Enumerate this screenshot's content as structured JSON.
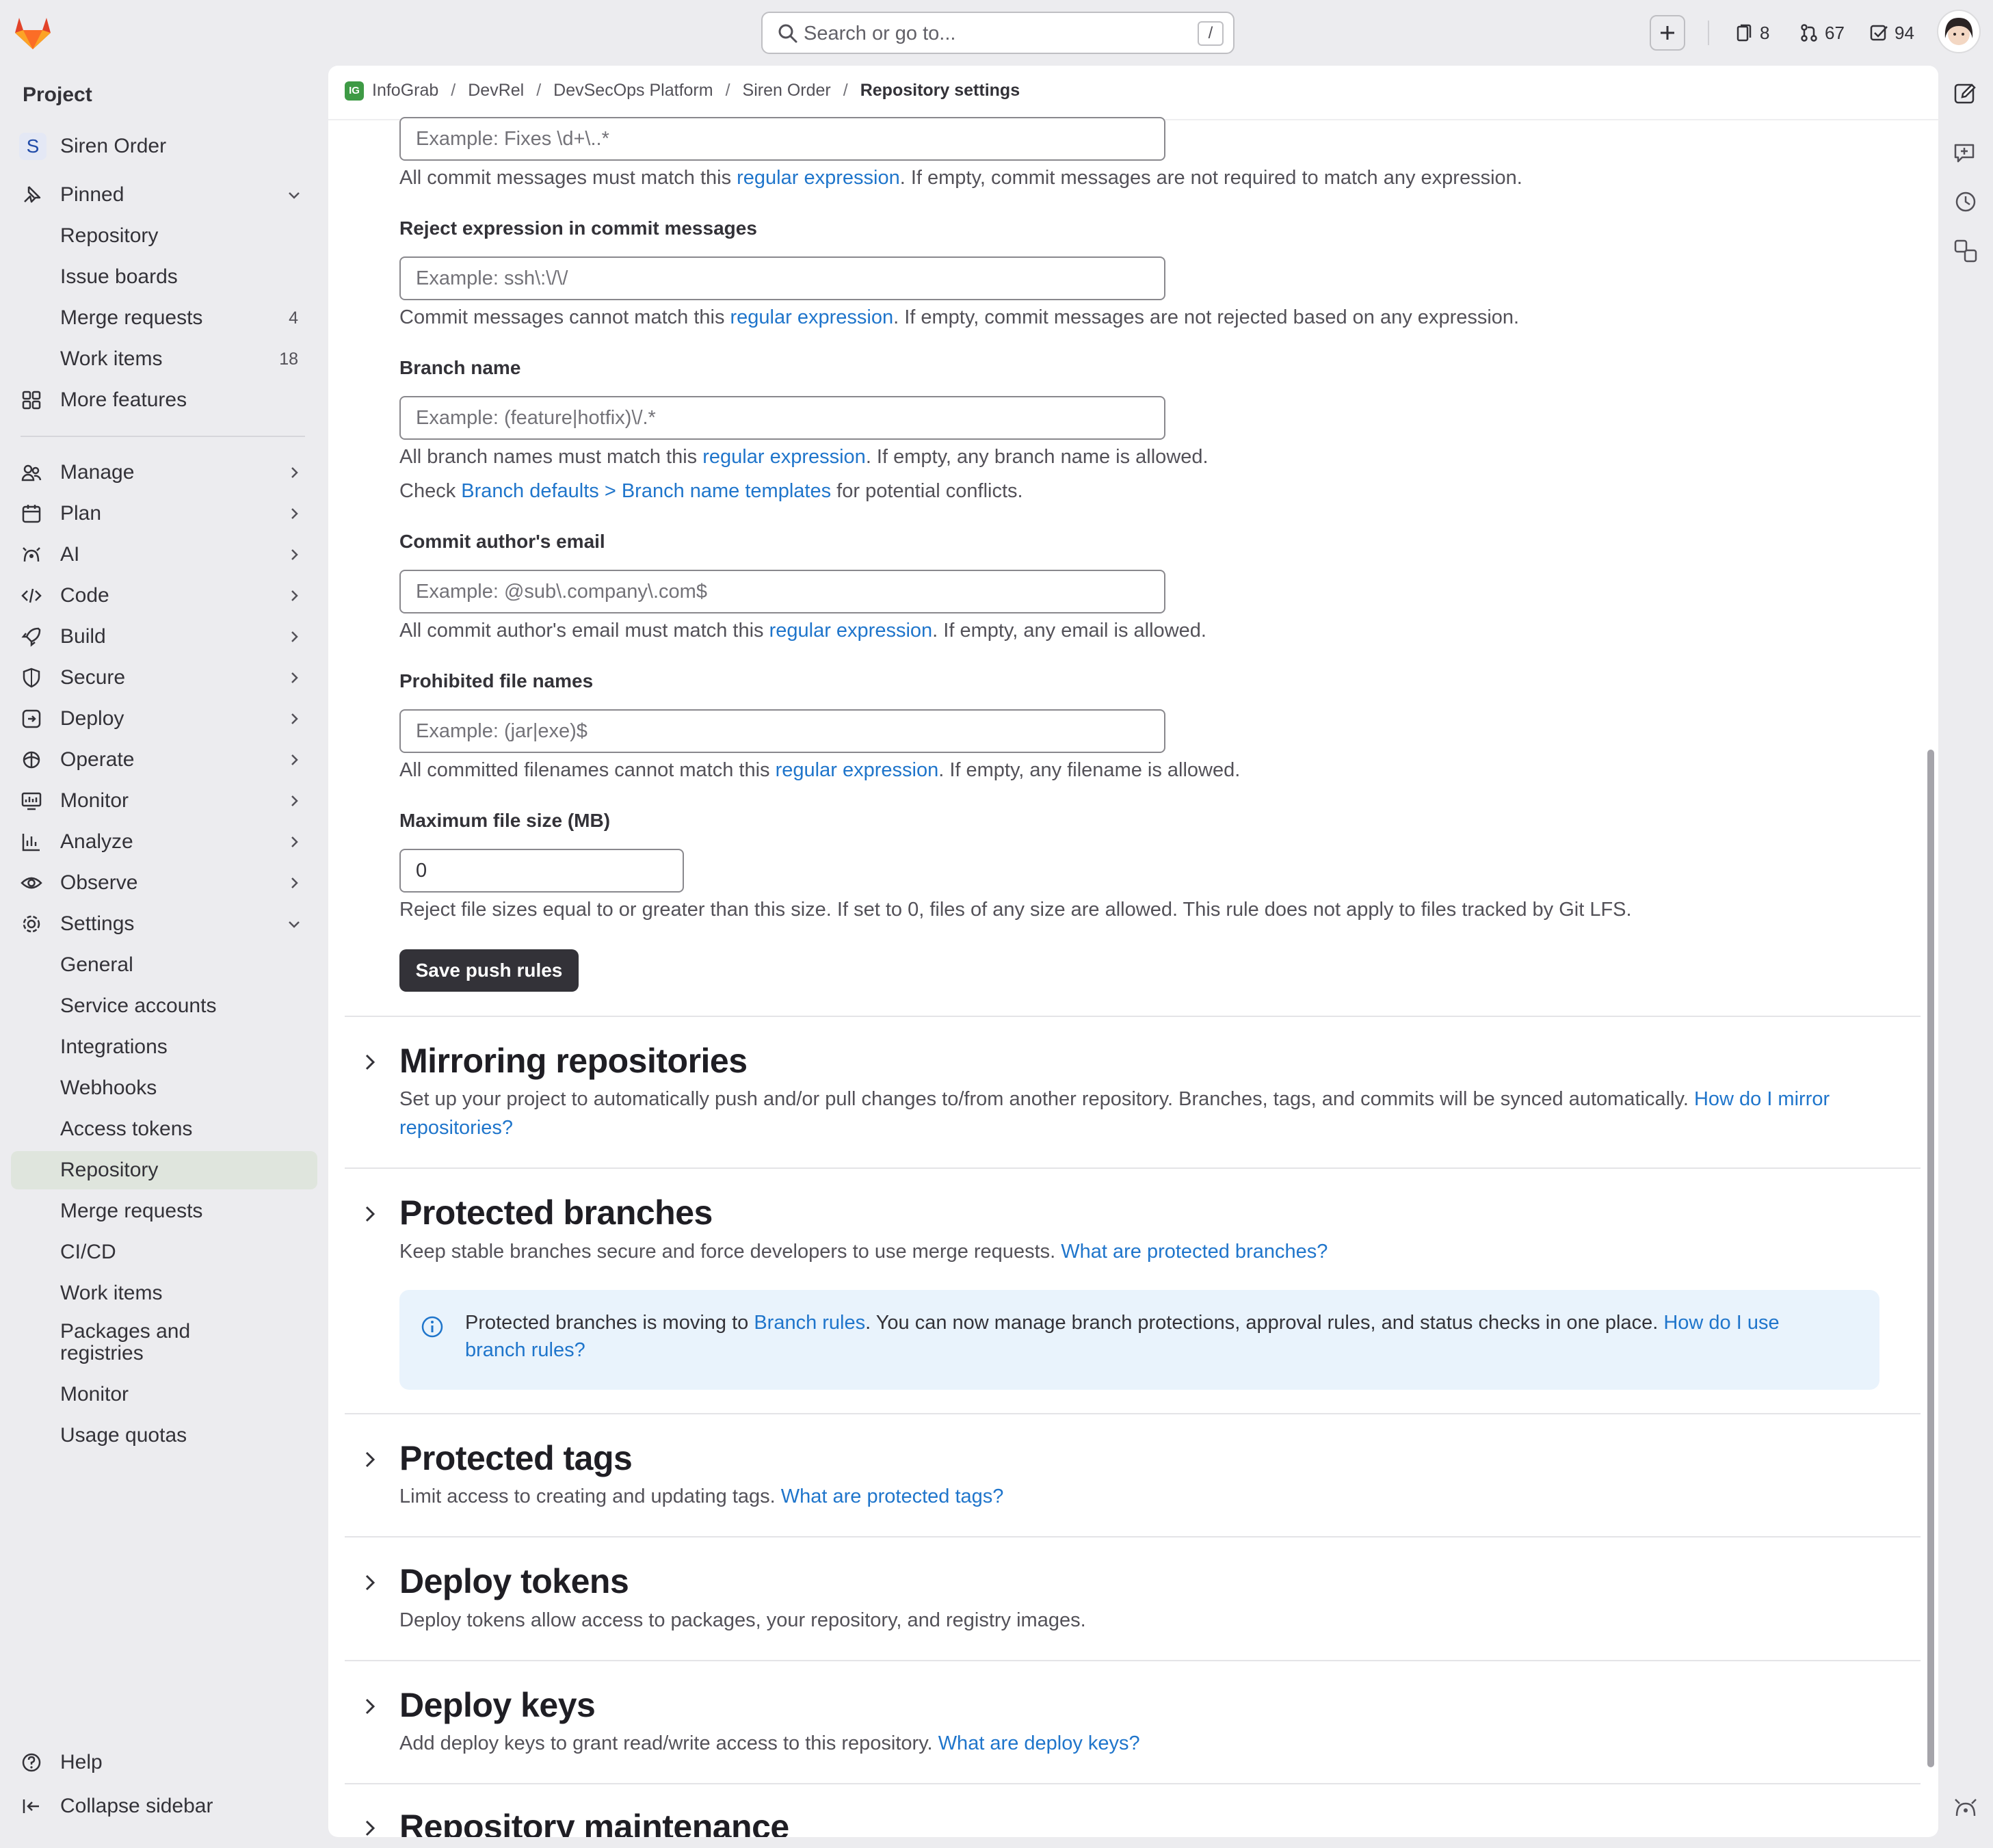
{
  "topbar": {
    "search_placeholder": "Search or go to...",
    "search_shortcut": "/",
    "issues_count": "8",
    "merge_requests_count": "67",
    "todos_count": "94"
  },
  "sidebar": {
    "heading": "Project",
    "project_initial": "S",
    "project_name": "Siren Order",
    "pinned_label": "Pinned",
    "pinned_items": [
      {
        "label": "Repository",
        "count": ""
      },
      {
        "label": "Issue boards",
        "count": ""
      },
      {
        "label": "Merge requests",
        "count": "4"
      },
      {
        "label": "Work items",
        "count": "18"
      }
    ],
    "more_features": "More features",
    "groups": [
      {
        "label": "Manage",
        "icon": "users-icon"
      },
      {
        "label": "Plan",
        "icon": "calendar-icon"
      },
      {
        "label": "AI",
        "icon": "ai-icon"
      },
      {
        "label": "Code",
        "icon": "code-icon"
      },
      {
        "label": "Build",
        "icon": "rocket-icon"
      },
      {
        "label": "Secure",
        "icon": "shield-icon"
      },
      {
        "label": "Deploy",
        "icon": "deploy-icon"
      },
      {
        "label": "Operate",
        "icon": "operate-icon"
      },
      {
        "label": "Monitor",
        "icon": "monitor-icon"
      },
      {
        "label": "Analyze",
        "icon": "chart-icon"
      },
      {
        "label": "Observe",
        "icon": "eye-icon"
      }
    ],
    "settings_label": "Settings",
    "settings_items": [
      "General",
      "Service accounts",
      "Integrations",
      "Webhooks",
      "Access tokens",
      "Repository",
      "Merge requests",
      "CI/CD",
      "Work items",
      "Packages and registries",
      "Monitor",
      "Usage quotas"
    ],
    "help": "Help",
    "collapse": "Collapse sidebar"
  },
  "breadcrumb": {
    "logo_text": "IG",
    "items": [
      "InfoGrab",
      "DevRel",
      "DevSecOps Platform",
      "Siren Order"
    ],
    "current": "Repository settings"
  },
  "push_rules": {
    "commit_msg_placeholder": "Example: Fixes \\d+\\..*",
    "commit_msg_help_pre": "All commit messages must match this ",
    "commit_msg_help_link": "regular expression",
    "commit_msg_help_post": ". If empty, commit messages are not required to match any expression.",
    "reject_label": "Reject expression in commit messages",
    "reject_placeholder": "Example: ssh\\:\\/\\/",
    "reject_help_pre": "Commit messages cannot match this ",
    "reject_help_link": "regular expression",
    "reject_help_post": ". If empty, commit messages are not rejected based on any expression.",
    "branch_label": "Branch name",
    "branch_placeholder": "Example: (feature|hotfix)\\/.*",
    "branch_help_pre": "All branch names must match this ",
    "branch_help_link": "regular expression",
    "branch_help_post": ". If empty, any branch name is allowed.",
    "branch_check_pre": "Check ",
    "branch_check_link": "Branch defaults > Branch name templates",
    "branch_check_post": " for potential conflicts.",
    "email_label": "Commit author's email",
    "email_placeholder": "Example: @sub\\.company\\.com$",
    "email_help_pre": "All commit author's email must match this ",
    "email_help_link": "regular expression",
    "email_help_post": ". If empty, any email is allowed.",
    "files_label": "Prohibited file names",
    "files_placeholder": "Example: (jar|exe)$",
    "files_help_pre": "All committed filenames cannot match this ",
    "files_help_link": "regular expression",
    "files_help_post": ". If empty, any filename is allowed.",
    "size_label": "Maximum file size (MB)",
    "size_value": "0",
    "size_help": "Reject file sizes equal to or greater than this size. If set to 0, files of any size are allowed. This rule does not apply to files tracked by Git LFS.",
    "save_button": "Save push rules"
  },
  "sections": {
    "mirroring": {
      "title": "Mirroring repositories",
      "desc": "Set up your project to automatically push and/or pull changes to/from another repository. Branches, tags, and commits will be synced automatically. ",
      "link": "How do I mirror repositories?"
    },
    "protected_branches": {
      "title": "Protected branches",
      "desc": "Keep stable branches secure and force developers to use merge requests. ",
      "link": "What are protected branches?",
      "alert_pre": "Protected branches is moving to ",
      "alert_link1": "Branch rules",
      "alert_mid": ". You can now manage branch protections, approval rules, and status checks in one place. ",
      "alert_link2": "How do I use branch rules?"
    },
    "protected_tags": {
      "title": "Protected tags",
      "desc": "Limit access to creating and updating tags. ",
      "link": "What are protected tags?"
    },
    "deploy_tokens": {
      "title": "Deploy tokens",
      "desc": "Deploy tokens allow access to packages, your repository, and registry images."
    },
    "deploy_keys": {
      "title": "Deploy keys",
      "desc": "Add deploy keys to grant read/write access to this repository. ",
      "link": "What are deploy keys?"
    },
    "maintenance": {
      "title": "Repository maintenance"
    }
  },
  "colors": {
    "accent_link": "#1f75cb",
    "brand": "#e24329",
    "active_nav": "#dfe5dd",
    "primary_button": "#333238",
    "alert_bg": "#e9f3fc"
  }
}
